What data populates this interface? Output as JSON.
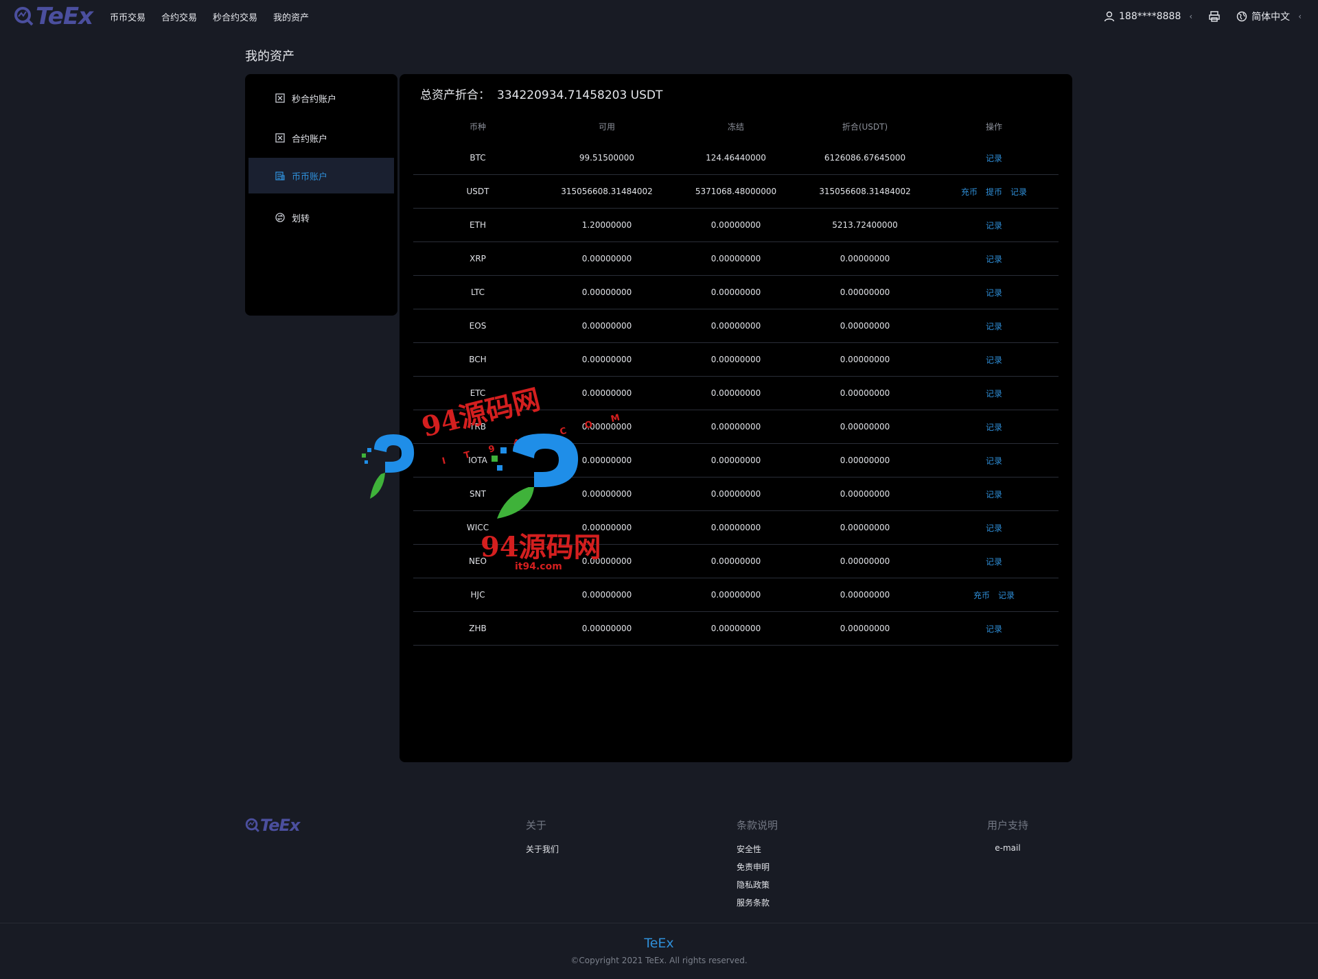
{
  "header": {
    "logo_text": "TeEx",
    "nav": [
      "币币交易",
      "合约交易",
      "秒合约交易",
      "我的资产"
    ],
    "user": "188****8888",
    "language": "简体中文"
  },
  "page_title": "我的资产",
  "sidebar": {
    "items": [
      {
        "label": "秒合约账户",
        "icon": "contract-icon"
      },
      {
        "label": "合约账户",
        "icon": "contract-icon"
      },
      {
        "label": "币币账户",
        "icon": "wallet-icon",
        "active": true
      },
      {
        "label": "划转",
        "icon": "transfer-icon"
      }
    ]
  },
  "summary": {
    "label": "总资产折合：",
    "value": "334220934.71458203 USDT"
  },
  "table": {
    "headers": [
      "币种",
      "可用",
      "冻结",
      "折合(USDT)",
      "操作"
    ],
    "rows": [
      {
        "coin": "BTC",
        "available": "99.51500000",
        "frozen": "124.46440000",
        "usdt": "6126086.67645000",
        "actions": [
          "记录"
        ]
      },
      {
        "coin": "USDT",
        "available": "315056608.31484002",
        "frozen": "5371068.48000000",
        "usdt": "315056608.31484002",
        "actions": [
          "充币",
          "提币",
          "记录"
        ]
      },
      {
        "coin": "ETH",
        "available": "1.20000000",
        "frozen": "0.00000000",
        "usdt": "5213.72400000",
        "actions": [
          "记录"
        ]
      },
      {
        "coin": "XRP",
        "available": "0.00000000",
        "frozen": "0.00000000",
        "usdt": "0.00000000",
        "actions": [
          "记录"
        ]
      },
      {
        "coin": "LTC",
        "available": "0.00000000",
        "frozen": "0.00000000",
        "usdt": "0.00000000",
        "actions": [
          "记录"
        ]
      },
      {
        "coin": "EOS",
        "available": "0.00000000",
        "frozen": "0.00000000",
        "usdt": "0.00000000",
        "actions": [
          "记录"
        ]
      },
      {
        "coin": "BCH",
        "available": "0.00000000",
        "frozen": "0.00000000",
        "usdt": "0.00000000",
        "actions": [
          "记录"
        ]
      },
      {
        "coin": "ETC",
        "available": "0.00000000",
        "frozen": "0.00000000",
        "usdt": "0.00000000",
        "actions": [
          "记录"
        ]
      },
      {
        "coin": "TRB",
        "available": "0.00000000",
        "frozen": "0.00000000",
        "usdt": "0.00000000",
        "actions": [
          "记录"
        ]
      },
      {
        "coin": "IOTA",
        "available": "0.00000000",
        "frozen": "0.00000000",
        "usdt": "0.00000000",
        "actions": [
          "记录"
        ]
      },
      {
        "coin": "SNT",
        "available": "0.00000000",
        "frozen": "0.00000000",
        "usdt": "0.00000000",
        "actions": [
          "记录"
        ]
      },
      {
        "coin": "WICC",
        "available": "0.00000000",
        "frozen": "0.00000000",
        "usdt": "0.00000000",
        "actions": [
          "记录"
        ]
      },
      {
        "coin": "NEO",
        "available": "0.00000000",
        "frozen": "0.00000000",
        "usdt": "0.00000000",
        "actions": [
          "记录"
        ]
      },
      {
        "coin": "HJC",
        "available": "0.00000000",
        "frozen": "0.00000000",
        "usdt": "0.00000000",
        "actions": [
          "充币",
          "记录"
        ]
      },
      {
        "coin": "ZHB",
        "available": "0.00000000",
        "frozen": "0.00000000",
        "usdt": "0.00000000",
        "actions": [
          "记录"
        ]
      }
    ]
  },
  "watermark": {
    "text1": "94源码网",
    "sub1": "IT94.COM",
    "text2": "94源码网",
    "sub2": "it94.com"
  },
  "footer": {
    "logo_text": "TeEx",
    "columns": [
      {
        "title": "关于",
        "links": [
          "关于我们"
        ]
      },
      {
        "title": "条款说明",
        "links": [
          "安全性",
          "免责申明",
          "隐私政策",
          "服务条款"
        ]
      },
      {
        "title": "用户支持",
        "links": [
          "e-mail"
        ]
      }
    ],
    "brand": "TeEx",
    "copyright": "©Copyright 2021 TeEx. All rights reserved."
  },
  "colors": {
    "background": "#181b24",
    "panel": "#000000",
    "accent": "#2f8fd9",
    "logo": "#4b4f9e",
    "watermark": "#d41f1f"
  }
}
